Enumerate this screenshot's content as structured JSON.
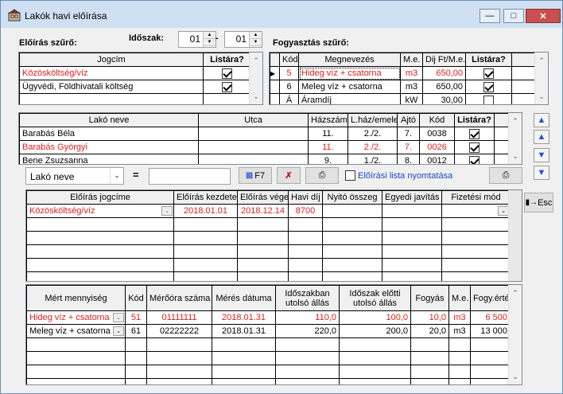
{
  "window": {
    "title": "Lakók havi előírása"
  },
  "filters": {
    "eloiras_label": "Előírás szűrő:",
    "idoszak_label": "Időszak:",
    "from": "01",
    "to": "01",
    "dash": "-",
    "fogyasztas_label": "Fogyasztás szűrő:"
  },
  "jogcim": {
    "headers": [
      "Jogcím",
      "Listára?"
    ],
    "rows": [
      {
        "name": "Közösköltség/víz",
        "checked": true,
        "red": true
      },
      {
        "name": "Ügyvédi, Földhivatali költség",
        "checked": true,
        "red": false
      },
      {
        "name": "",
        "checked": false,
        "red": false
      }
    ]
  },
  "fogy": {
    "headers": [
      "Kód",
      "Megnevezés",
      "M.e.",
      "Dij Ft/M.e.",
      "Listára?"
    ],
    "rows": [
      {
        "kod": "5",
        "nev": "Hideg víz + csatorna",
        "me": "m3",
        "dij": "650,00",
        "checked": true,
        "red": true,
        "current": true
      },
      {
        "kod": "6",
        "nev": "Meleg víz + csatorna",
        "me": "m3",
        "dij": "650,00",
        "checked": true,
        "red": false
      },
      {
        "kod": "Á",
        "nev": "Áramdíj",
        "me": "kW",
        "dij": "30,00",
        "checked": false,
        "red": false
      }
    ]
  },
  "lakok": {
    "headers": [
      "Lakó neve",
      "Utca",
      "Házszám",
      "L.ház/emelet",
      "Ajtó",
      "Kód",
      "Listára?"
    ],
    "rows": [
      {
        "nev": "Barabás Béla",
        "utca": "",
        "hazszam": "11.",
        "emelet": "2./2.",
        "ajto": "7.",
        "kod": "0038",
        "checked": true,
        "red": false
      },
      {
        "nev": "Barabás Györgyi",
        "utca": "",
        "hazszam": "11.",
        "emelet": "2./2.",
        "ajto": "7.",
        "kod": "0026",
        "checked": true,
        "red": true
      },
      {
        "nev": "Bene Zsuzsanna",
        "utca": "",
        "hazszam": "9.",
        "emelet": "1./2.",
        "ajto": "8.",
        "kod": "0012",
        "checked": true,
        "red": false
      }
    ]
  },
  "search": {
    "field": "Lakó neve",
    "eq": "=",
    "value": "",
    "f7": "F7",
    "eloirasi_lista": "Előírási lista nyomtatása"
  },
  "eloiras": {
    "headers": [
      "Előírás jogcíme",
      "Előírás kezdete",
      "Előírás vége",
      "Havi díj",
      "Nyitó összeg",
      "Egyedi javítás",
      "Fizetési mód"
    ],
    "rows": [
      {
        "jogcim": "Közösköltség/víz",
        "kezdete": "2018.01.01",
        "vege": "2018.12.14",
        "havi": "8700",
        "nyito": "",
        "egyedi": "",
        "fizetesi": ""
      }
    ]
  },
  "meres": {
    "headers": [
      "Mért mennyiség",
      "Kód",
      "Mérőóra száma",
      "Mérés dátuma",
      "Időszakban utolsó állás",
      "Időszak előtti utolsó állás",
      "Fogyás",
      "M.e.",
      "Fogy.érték"
    ],
    "rows": [
      {
        "menny": "Hideg víz + csatorna",
        "kod": "51",
        "ora": "01111111",
        "datum": "2018.01.31",
        "utolso": "110,0",
        "elotti": "100,0",
        "fogyas": "10,0",
        "me": "m3",
        "ertek": "6 500",
        "red": true
      },
      {
        "menny": "Meleg víz + csatorna",
        "kod": "61",
        "ora": "02222222",
        "datum": "2018.01.31",
        "utolso": "220,0",
        "elotti": "200,0",
        "fogyas": "20,0",
        "me": "m3",
        "ertek": "13 000",
        "red": false
      }
    ]
  },
  "esc_label": "Esc"
}
